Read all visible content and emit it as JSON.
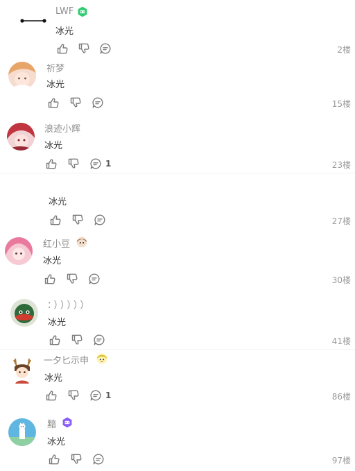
{
  "comments": [
    {
      "user": "LWF",
      "text": "冰光",
      "floor": "2楼",
      "reply_count": ""
    },
    {
      "user": "祈梦",
      "text": "冰光",
      "floor": "15楼",
      "reply_count": ""
    },
    {
      "user": "浪迹小辉",
      "text": "冰光",
      "floor": "23楼",
      "reply_count": "1"
    },
    {
      "user": "",
      "text": "冰光",
      "floor": "27楼",
      "reply_count": ""
    },
    {
      "user": "红小豆",
      "text": "冰光",
      "floor": "30楼",
      "reply_count": ""
    },
    {
      "user": "：）））））",
      "text": "冰光",
      "floor": "41楼",
      "reply_count": ""
    },
    {
      "user": "一夕匕示申",
      "text": "冰光",
      "floor": "86楼",
      "reply_count": "1"
    },
    {
      "user": "黯",
      "text": "冰光",
      "floor": "97楼",
      "reply_count": ""
    }
  ],
  "colors": {
    "badge_green": "#2ecc71",
    "badge_purple": "#8a5cf6",
    "icon_gray": "#7a7a7a"
  }
}
